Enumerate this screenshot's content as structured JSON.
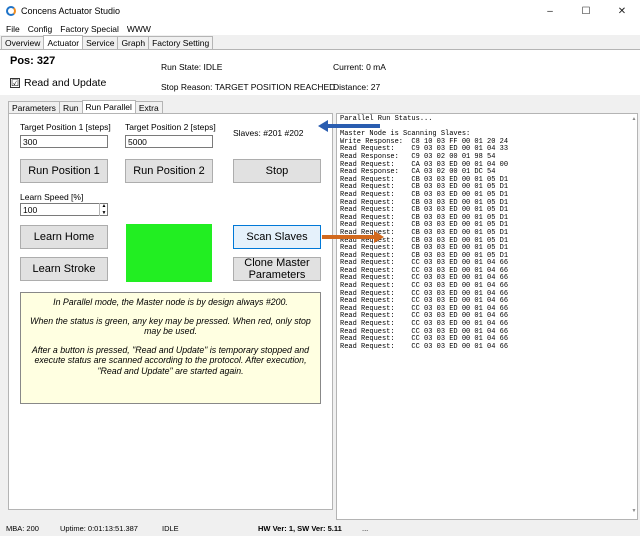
{
  "window": {
    "title": "Concens Actuator Studio",
    "controls": {
      "minimize": "–",
      "maximize": "☐",
      "close": "✕"
    }
  },
  "menu": [
    "File",
    "Config",
    "Factory Special",
    "WWW"
  ],
  "tabs": [
    "Overview",
    "Actuator",
    "Service",
    "Graph",
    "Factory Setting"
  ],
  "active_tab": "Actuator",
  "info": {
    "pos": "Pos: 327",
    "read_update_checked": "☑",
    "read_update_label": "Read and Update",
    "run_state": "Run State: IDLE",
    "stop_reason": "Stop Reason: TARGET POSITION REACHED",
    "current": "Current: 0 mA",
    "distance": "Distance: 27"
  },
  "subtabs": [
    "Parameters",
    "Run",
    "Run Parallel",
    "Extra"
  ],
  "active_subtab": "Run Parallel",
  "form": {
    "target1_label": "Target Position 1 [steps]",
    "target1_value": "300",
    "target2_label": "Target Position 2 [steps]",
    "target2_value": "5000",
    "slaves": "Slaves: #201 #202",
    "learn_speed_label": "Learn Speed [%]",
    "learn_speed_value": "100",
    "spin_up": "▲",
    "spin_down": "▼"
  },
  "buttons": {
    "run_position_1": "Run Position 1",
    "run_position_2": "Run Position 2",
    "stop": "Stop",
    "learn_home": "Learn Home",
    "scan_slaves": "Scan Slaves",
    "learn_stroke": "Learn Stroke",
    "clone_master_line1": "Clone Master",
    "clone_master_line2": "Parameters"
  },
  "status_color": "#22ee22",
  "accent_colors": {
    "blue_arrow": "#2a5db0",
    "orange_arrow": "#d2691e"
  },
  "note": {
    "p1": "In Parallel mode, the Master node is by design always #200.",
    "p2": "When the status is green, any key may be pressed. When red, only stop may be used.",
    "p3": "After a button is pressed, \"Read and Update\" is temporary stopped and execute status are scanned according to the protocol. After execution, \"Read and Update\" are started again."
  },
  "log": [
    "Parallel Run Status...",
    "",
    "Master Node is Scanning Slaves:",
    "Write Response:  C8 10 03 FF 00 01 20 24",
    "Read Request:    C9 03 03 ED 00 01 04 33",
    "Read Response:   C9 03 02 00 01 98 54",
    "Read Request:    CA 03 03 ED 00 01 04 00",
    "Read Response:   CA 03 02 00 01 DC 54",
    "Read Request:    CB 03 03 ED 00 01 05 D1",
    "Read Request:    CB 03 03 ED 00 01 05 D1",
    "Read Request:    CB 03 03 ED 00 01 05 D1",
    "Read Request:    CB 03 03 ED 00 01 05 D1",
    "Read Request:    CB 03 03 ED 00 01 05 D1",
    "Read Request:    CB 03 03 ED 00 01 05 D1",
    "Read Request:    CB 03 03 ED 00 01 05 D1",
    "Read Request:    CB 03 03 ED 00 01 05 D1",
    "Read Request:    CB 03 03 ED 00 01 05 D1",
    "Read Request:    CB 03 03 ED 00 01 05 D1",
    "Read Request:    CB 03 03 ED 00 01 05 D1",
    "Read Request:    CC 03 03 ED 00 01 04 66",
    "Read Request:    CC 03 03 ED 00 01 04 66",
    "Read Request:    CC 03 03 ED 00 01 04 66",
    "Read Request:    CC 03 03 ED 00 01 04 66",
    "Read Request:    CC 03 03 ED 00 01 04 66",
    "Read Request:    CC 03 03 ED 00 01 04 66",
    "Read Request:    CC 03 03 ED 00 01 04 66",
    "Read Request:    CC 03 03 ED 00 01 04 66",
    "Read Request:    CC 03 03 ED 00 01 04 66",
    "Read Request:    CC 03 03 ED 00 01 04 66",
    "Read Request:    CC 03 03 ED 00 01 04 66",
    "Read Request:    CC 03 03 ED 00 01 04 66"
  ],
  "scroll": {
    "up": "▲",
    "down": "▼"
  },
  "statusbar": {
    "mba": "MBA: 200",
    "uptime": "Uptime: 0:01:13:51.387",
    "state": "IDLE",
    "version": "HW Ver: 1, SW Ver: 5.11",
    "extra": "..."
  }
}
